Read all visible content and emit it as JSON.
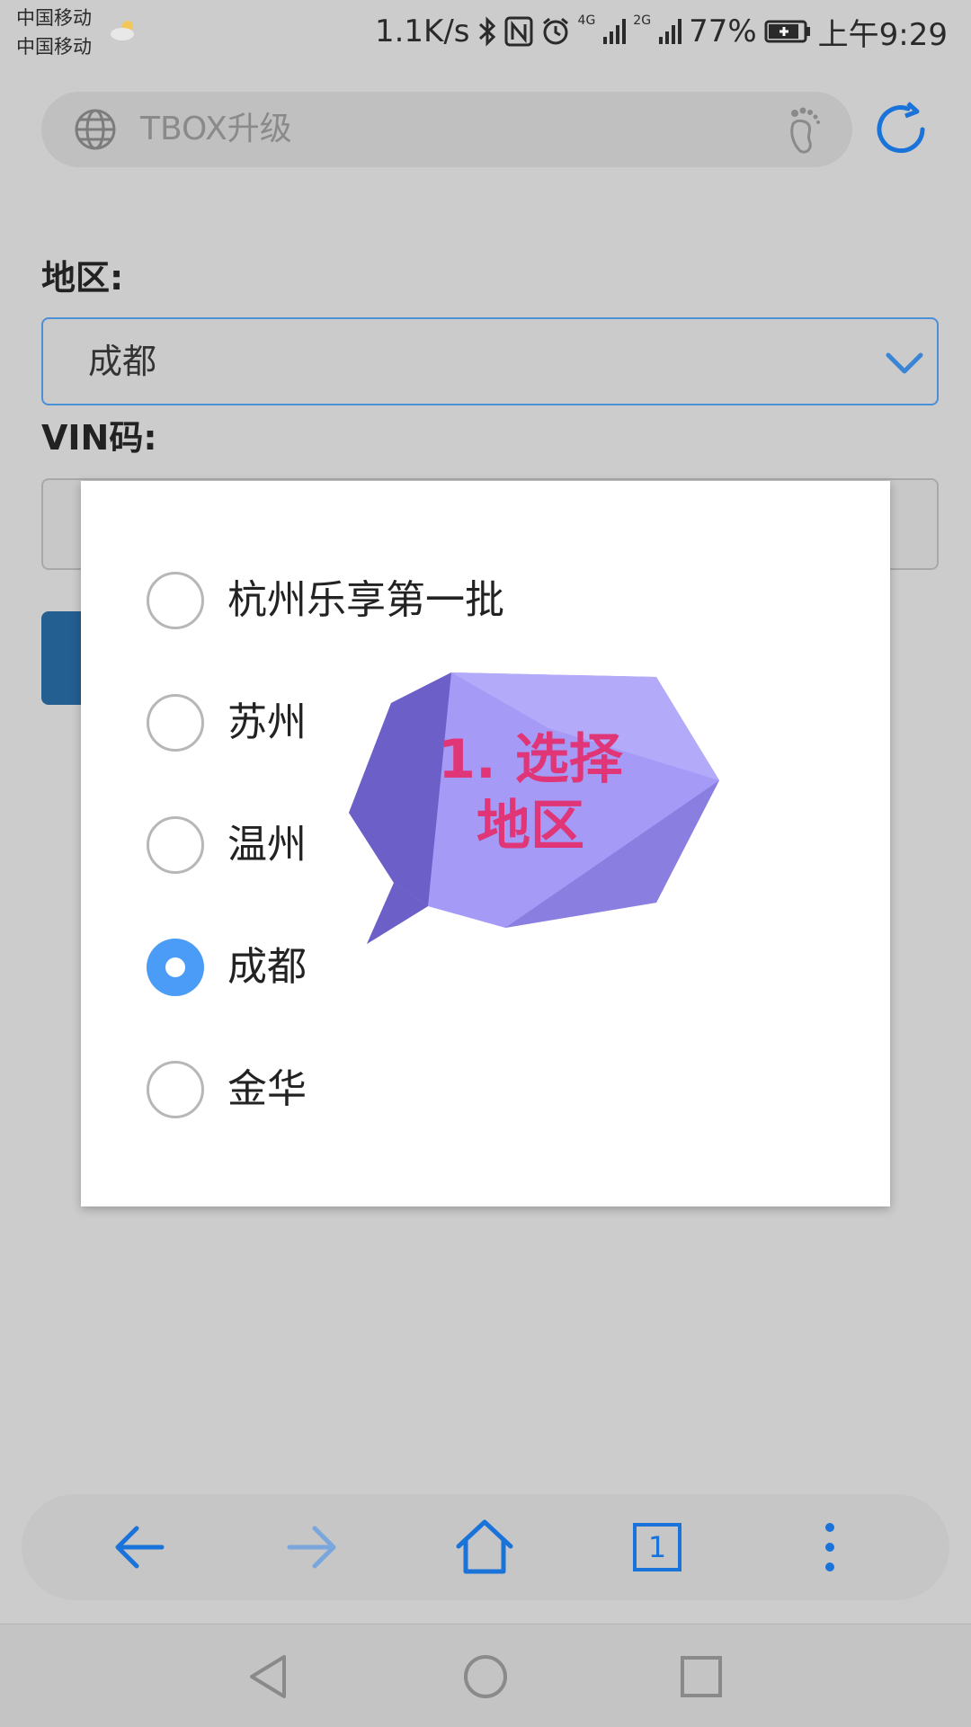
{
  "status_bar": {
    "carrier_1": "中国移动",
    "carrier_2": "中国移动",
    "network_speed": "1.1K/s",
    "network_1": "4G",
    "network_2": "2G",
    "battery_percent": "77%",
    "time": "上午9:29",
    "icons": [
      "weather-icon",
      "bluetooth-icon",
      "nfc-icon",
      "alarm-icon",
      "signal-icon",
      "battery-icon"
    ]
  },
  "browser": {
    "address_text": "TBOX升级",
    "icons": [
      "globe-icon",
      "footprint-icon",
      "reload-icon"
    ]
  },
  "form": {
    "region_label": "地区:",
    "region_value": "成都",
    "vin_label": "VIN码:"
  },
  "dialog": {
    "options": [
      {
        "label": "杭州乐享第一批",
        "selected": false
      },
      {
        "label": "苏州",
        "selected": false
      },
      {
        "label": "温州",
        "selected": false
      },
      {
        "label": "成都",
        "selected": true
      },
      {
        "label": "金华",
        "selected": false
      }
    ]
  },
  "annotation": {
    "line1": "1. 选择",
    "line2": "地区",
    "color": "#e03577"
  },
  "toolbar": {
    "tabs_count": "1",
    "icons": [
      "back-icon",
      "forward-icon",
      "home-icon",
      "tabs-icon",
      "more-icon"
    ]
  },
  "nav_bar": {
    "icons": [
      "nav-back-icon",
      "nav-home-icon",
      "nav-recents-icon"
    ]
  },
  "colors": {
    "accent": "#1a73d9",
    "radio_selected": "#4a9cf6",
    "bubble": "#a59bf7"
  }
}
